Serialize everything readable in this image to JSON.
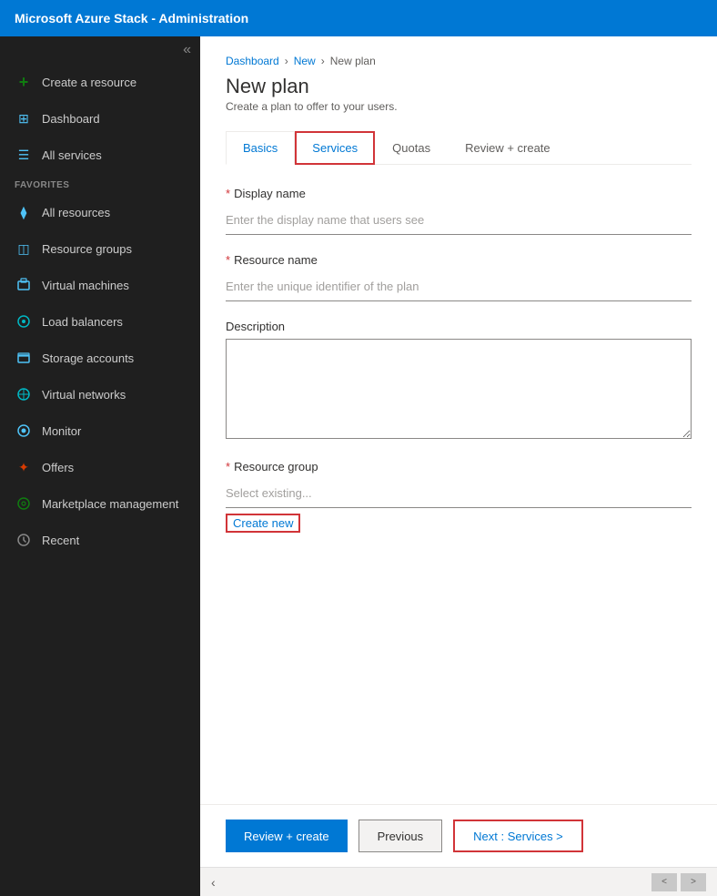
{
  "app": {
    "title": "Microsoft Azure Stack - Administration"
  },
  "sidebar": {
    "collapse_label": "«",
    "items": [
      {
        "id": "create-resource",
        "label": "Create a resource",
        "icon": "+",
        "icon_color": "icon-green"
      },
      {
        "id": "dashboard",
        "label": "Dashboard",
        "icon": "⊞",
        "icon_color": "icon-blue"
      },
      {
        "id": "all-services",
        "label": "All services",
        "icon": "☰",
        "icon_color": "icon-blue"
      },
      {
        "id": "favorites-section",
        "label": "FAVORITES",
        "type": "section"
      },
      {
        "id": "all-resources",
        "label": "All resources",
        "icon": "⧫",
        "icon_color": "icon-blue"
      },
      {
        "id": "resource-groups",
        "label": "Resource groups",
        "icon": "◫",
        "icon_color": "icon-blue"
      },
      {
        "id": "virtual-machines",
        "label": "Virtual machines",
        "icon": "□",
        "icon_color": "icon-blue"
      },
      {
        "id": "load-balancers",
        "label": "Load balancers",
        "icon": "⊗",
        "icon_color": "icon-teal"
      },
      {
        "id": "storage-accounts",
        "label": "Storage accounts",
        "icon": "▭",
        "icon_color": "icon-blue"
      },
      {
        "id": "virtual-networks",
        "label": "Virtual networks",
        "icon": "⊕",
        "icon_color": "icon-teal"
      },
      {
        "id": "monitor",
        "label": "Monitor",
        "icon": "◉",
        "icon_color": "icon-blue"
      },
      {
        "id": "offers",
        "label": "Offers",
        "icon": "✦",
        "icon_color": "icon-orange"
      },
      {
        "id": "marketplace-management",
        "label": "Marketplace management",
        "icon": "⊙",
        "icon_color": "icon-green"
      },
      {
        "id": "recent",
        "label": "Recent",
        "icon": "🕐",
        "icon_color": "icon-gray"
      }
    ]
  },
  "breadcrumb": {
    "items": [
      "Dashboard",
      "New",
      "New plan"
    ],
    "separators": [
      ">",
      ">"
    ]
  },
  "page": {
    "title": "New plan",
    "subtitle": "Create a plan to offer to your users."
  },
  "tabs": [
    {
      "id": "basics",
      "label": "Basics",
      "active": true,
      "highlighted": false
    },
    {
      "id": "services",
      "label": "Services",
      "active": false,
      "highlighted": true
    },
    {
      "id": "quotas",
      "label": "Quotas",
      "active": false,
      "highlighted": false
    },
    {
      "id": "review-create",
      "label": "Review + create",
      "active": false,
      "highlighted": false
    }
  ],
  "form": {
    "display_name": {
      "label": "Display name",
      "required": true,
      "placeholder": "Enter the display name that users see",
      "value": ""
    },
    "resource_name": {
      "label": "Resource name",
      "required": true,
      "placeholder": "Enter the unique identifier of the plan",
      "value": ""
    },
    "description": {
      "label": "Description",
      "required": false,
      "value": ""
    },
    "resource_group": {
      "label": "Resource group",
      "required": true,
      "placeholder": "Select existing...",
      "value": ""
    },
    "create_new_label": "Create new"
  },
  "footer": {
    "review_create_label": "Review + create",
    "previous_label": "Previous",
    "next_label": "Next : Services >"
  },
  "bottom_bar": {
    "collapse_icon": "‹",
    "scroll_left": "<",
    "scroll_right": ">"
  }
}
